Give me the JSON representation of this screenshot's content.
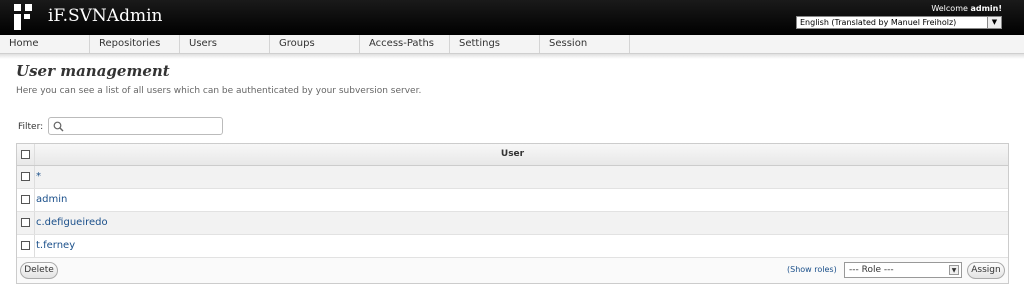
{
  "header": {
    "app_title": "iF.SVNAdmin",
    "welcome_prefix": "Welcome ",
    "welcome_user": "admin!",
    "language": "English (Translated by Manuel Freiholz)"
  },
  "nav": [
    {
      "label": "Home"
    },
    {
      "label": "Repositories"
    },
    {
      "label": "Users"
    },
    {
      "label": "Groups"
    },
    {
      "label": "Access-Paths"
    },
    {
      "label": "Settings"
    },
    {
      "label": "Session"
    }
  ],
  "page": {
    "title": "User management",
    "description": "Here you can see a list of all users which can be authenticated by your subversion server."
  },
  "filter": {
    "label": "Filter:",
    "placeholder": ""
  },
  "table": {
    "column_header": "User",
    "rows": [
      "*",
      "admin",
      "c.defigueiredo",
      "t.ferney"
    ]
  },
  "footer": {
    "delete_label": "Delete",
    "show_roles": "(Show roles)",
    "role_selected": "--- Role ---",
    "assign_label": "Assign"
  }
}
